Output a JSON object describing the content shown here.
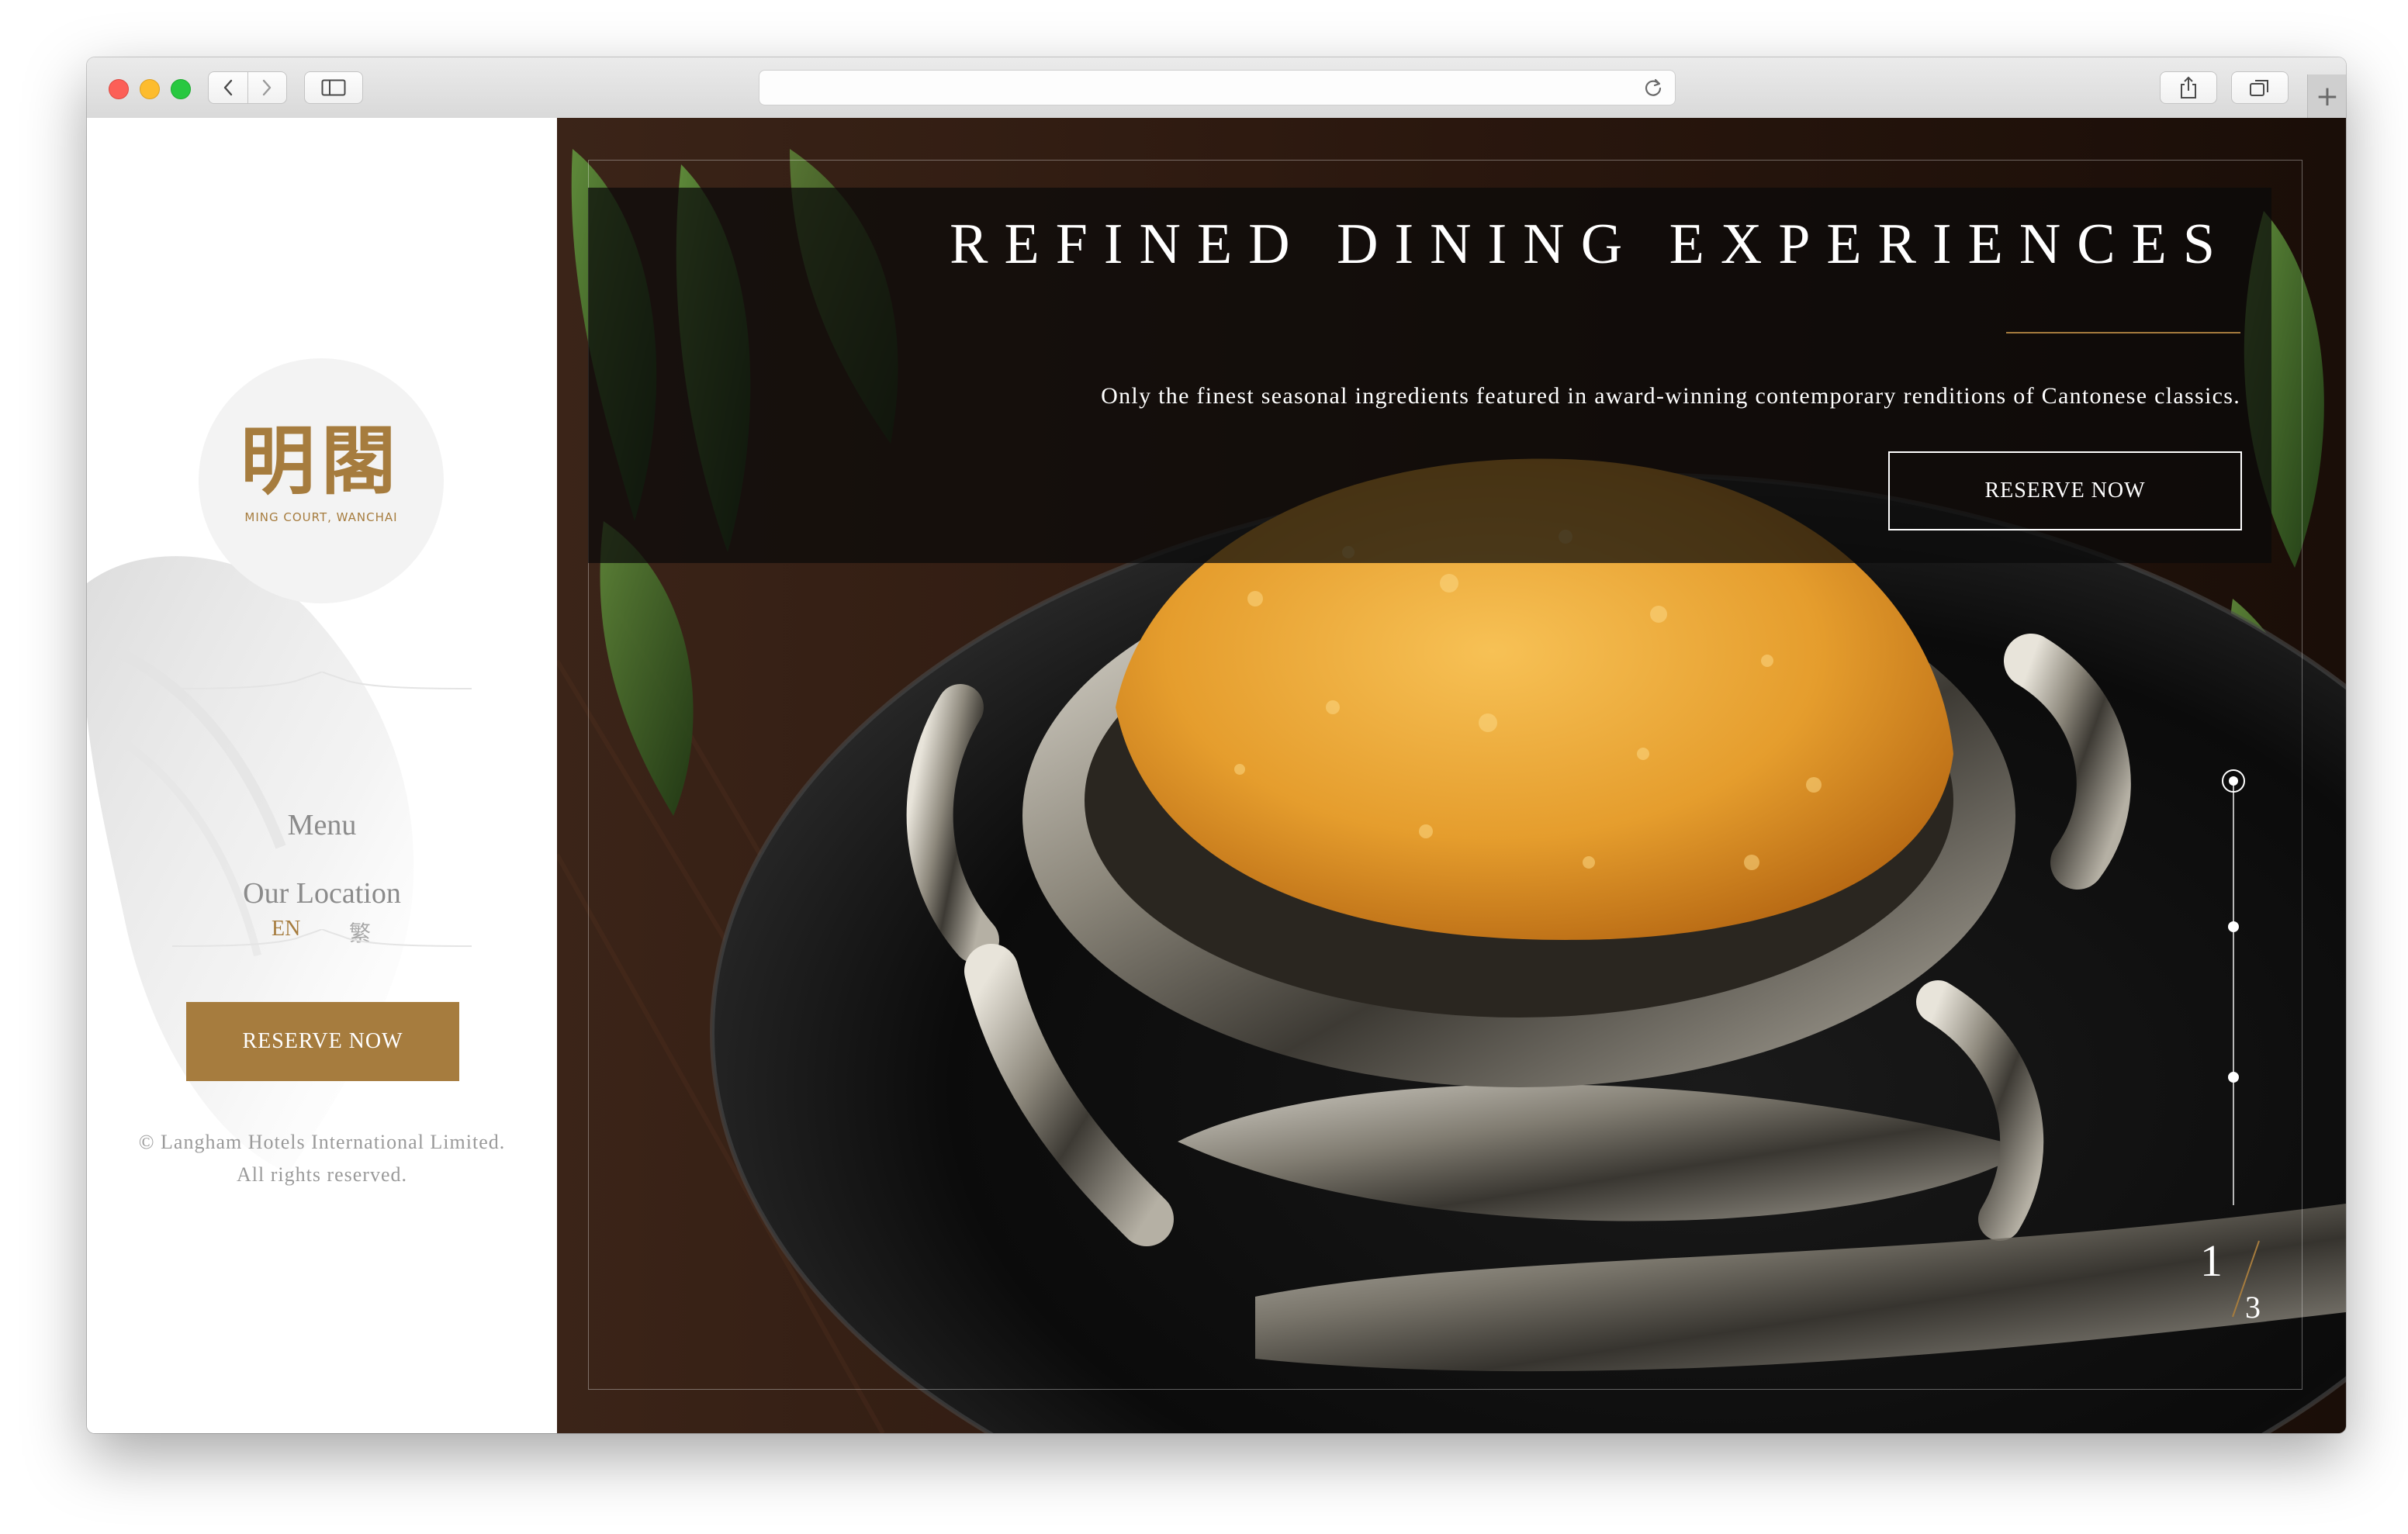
{
  "browser": {
    "url": "",
    "icons": {
      "back": "chevron-left-icon",
      "forward": "chevron-right-icon",
      "sidebar": "sidebar-icon",
      "reload": "reload-icon",
      "share": "share-icon",
      "tabs": "tabs-icon",
      "new_tab": "plus-icon"
    },
    "new_tab_label": "+"
  },
  "sidebar": {
    "logo": {
      "chinese": "明閣",
      "subtitle": "MING COURT, WANCHAI"
    },
    "nav": [
      {
        "label": "Menu"
      },
      {
        "label": "Our Location"
      }
    ],
    "languages": [
      {
        "label": "EN",
        "active": true
      },
      {
        "label": "繁",
        "active": false
      }
    ],
    "reserve_label": "RESERVE NOW",
    "copyright_line1": "© Langham Hotels International Limited.",
    "copyright_line2": "All rights reserved."
  },
  "hero": {
    "title": "REFINED DINING EXPERIENCES",
    "description": "Only the finest seasonal ingredients featured in award-winning contemporary renditions of Cantonese classics.",
    "reserve_label": "RESERVE NOW",
    "pagination": {
      "current": "1",
      "total": "3",
      "active_index": 0,
      "dot_count": 3
    }
  },
  "colors": {
    "accent_gold": "#a67c3e",
    "overlay": "#0a0a0a",
    "text_grey": "#8b8b8b"
  }
}
